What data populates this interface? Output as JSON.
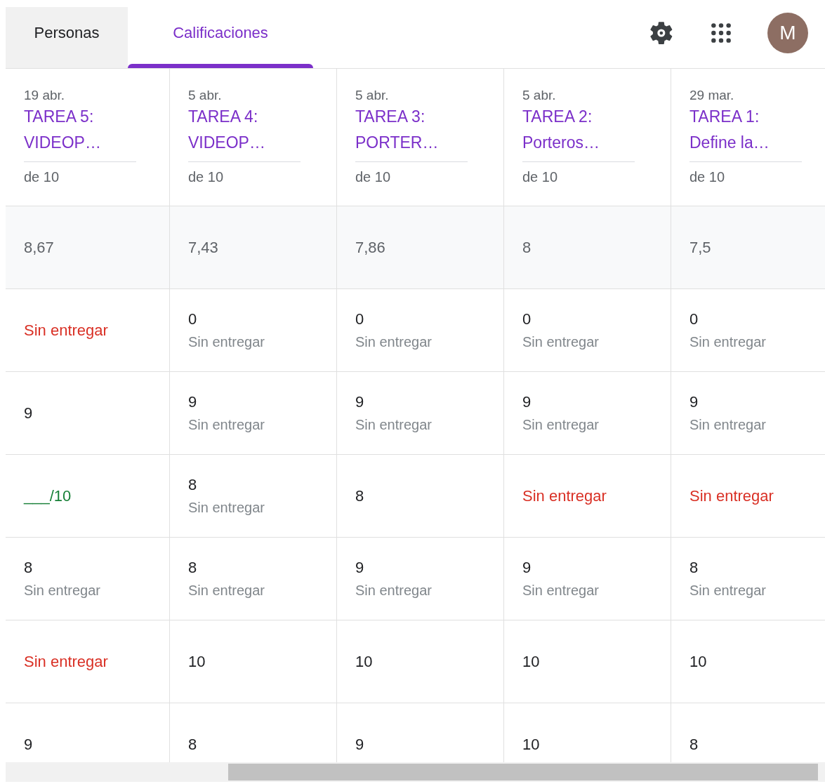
{
  "tabs": [
    {
      "label": "Personas",
      "selected": false
    },
    {
      "label": "Calificaciones",
      "selected": true
    }
  ],
  "account": {
    "initial": "M"
  },
  "assignments": [
    {
      "date": "19 abr.",
      "title": "TAREA 5: VIDEOP…",
      "points": "de 10",
      "average": "8,67"
    },
    {
      "date": "5 abr.",
      "title": "TAREA 4: VIDEOP…",
      "points": "de 10",
      "average": "7,43"
    },
    {
      "date": "5 abr.",
      "title": "TAREA 3: PORTER…",
      "points": "de 10",
      "average": "7,86"
    },
    {
      "date": "5 abr.",
      "title": "TAREA 2: Porteros…",
      "points": "de 10",
      "average": "8"
    },
    {
      "date": "29 mar.",
      "title": "TAREA 1: Define la…",
      "points": "de 10",
      "average": "7,5"
    }
  ],
  "rows": [
    [
      {
        "kind": "missing",
        "text": "Sin entregar"
      },
      {
        "kind": "grade",
        "text": "0",
        "note": "Sin entregar"
      },
      {
        "kind": "grade",
        "text": "0",
        "note": "Sin entregar"
      },
      {
        "kind": "grade",
        "text": "0",
        "note": "Sin entregar"
      },
      {
        "kind": "grade",
        "text": "0",
        "note": "Sin entregar"
      }
    ],
    [
      {
        "kind": "grade",
        "text": "9"
      },
      {
        "kind": "grade",
        "text": "9",
        "note": "Sin entregar"
      },
      {
        "kind": "grade",
        "text": "9",
        "note": "Sin entregar"
      },
      {
        "kind": "grade",
        "text": "9",
        "note": "Sin entregar"
      },
      {
        "kind": "grade",
        "text": "9",
        "note": "Sin entregar"
      }
    ],
    [
      {
        "kind": "draft",
        "text": "___/10"
      },
      {
        "kind": "grade",
        "text": "8",
        "note": "Sin entregar"
      },
      {
        "kind": "grade",
        "text": "8"
      },
      {
        "kind": "missing",
        "text": "Sin entregar"
      },
      {
        "kind": "missing",
        "text": "Sin entregar"
      }
    ],
    [
      {
        "kind": "grade",
        "text": "8",
        "note": "Sin entregar"
      },
      {
        "kind": "grade",
        "text": "8",
        "note": "Sin entregar"
      },
      {
        "kind": "grade",
        "text": "9",
        "note": "Sin entregar"
      },
      {
        "kind": "grade",
        "text": "9",
        "note": "Sin entregar"
      },
      {
        "kind": "grade",
        "text": "8",
        "note": "Sin entregar"
      }
    ],
    [
      {
        "kind": "missing",
        "text": "Sin entregar"
      },
      {
        "kind": "grade",
        "text": "10"
      },
      {
        "kind": "grade",
        "text": "10"
      },
      {
        "kind": "grade",
        "text": "10"
      },
      {
        "kind": "grade",
        "text": "10"
      }
    ],
    [
      {
        "kind": "grade",
        "text": "9"
      },
      {
        "kind": "grade",
        "text": "8"
      },
      {
        "kind": "grade",
        "text": "9"
      },
      {
        "kind": "grade",
        "text": "10"
      },
      {
        "kind": "grade",
        "text": "8"
      }
    ]
  ]
}
